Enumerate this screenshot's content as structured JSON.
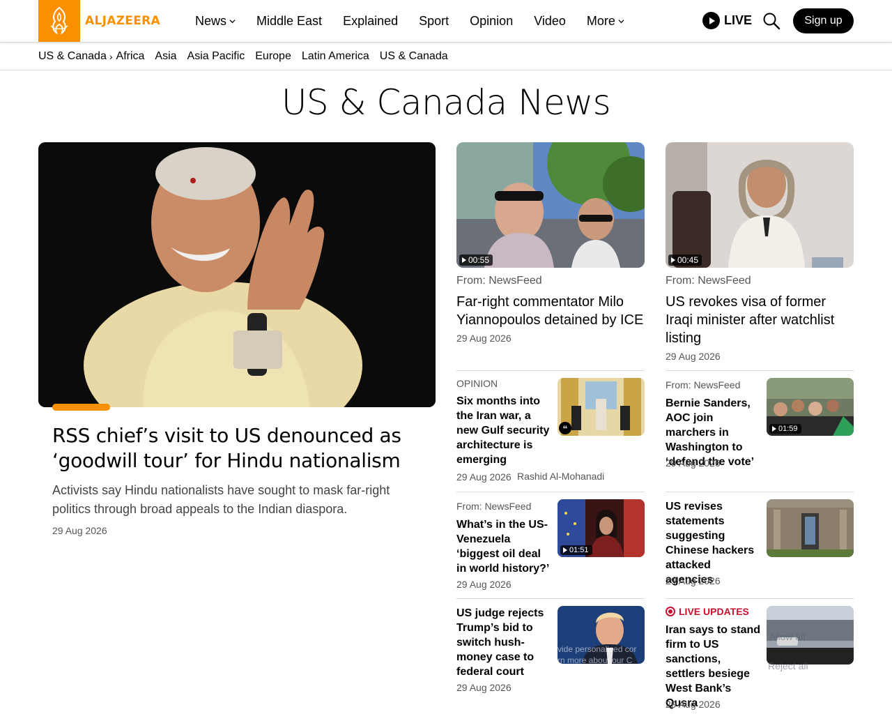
{
  "brand": {
    "name": "ALJAZEERA",
    "color": "#fa9000"
  },
  "nav": {
    "items": [
      {
        "label": "News",
        "dropdown": true
      },
      {
        "label": "Middle East",
        "dropdown": false
      },
      {
        "label": "Explained",
        "dropdown": false
      },
      {
        "label": "Sport",
        "dropdown": false
      },
      {
        "label": "Opinion",
        "dropdown": false
      },
      {
        "label": "Video",
        "dropdown": false
      },
      {
        "label": "More",
        "dropdown": true
      }
    ],
    "live_label": "LIVE",
    "signup_label": "Sign up"
  },
  "subnav": {
    "current": "US & Canada",
    "links": [
      "Africa",
      "Asia",
      "Asia Pacific",
      "Europe",
      "Latin America",
      "US & Canada"
    ]
  },
  "page_title": "US & Canada News",
  "featured": {
    "title": "RSS chief’s visit to US denounced as ‘goodwill tour’ for Hindu nationalism",
    "summary": "Activists say Hindu nationalists have sought to mask far-right politics through broad appeals to the Indian diaspora.",
    "date": "29 Aug 2026"
  },
  "cards": [
    {
      "source": "From: NewsFeed",
      "title": "Far-right commentator Milo Yiannopoulos detained by ICE",
      "date": "29 Aug 2026",
      "duration": "00:55"
    },
    {
      "source": "From: NewsFeed",
      "title": "US revokes visa of former Iraqi minister after watchlist listing",
      "date": "29 Aug 2026",
      "duration": "00:45"
    }
  ],
  "small_left": [
    {
      "label": "OPINION",
      "title": "Six months into the Iran war, a new Gulf security architecture is emerging",
      "date": "29 Aug 2026",
      "author": "Rashid Al-Mohanadi"
    },
    {
      "label": "From: NewsFeed",
      "title": "What’s in the US-Venezuela ‘biggest oil deal in world history?’",
      "date": "29 Aug 2026",
      "duration": "01:51"
    },
    {
      "title": "US judge rejects Trump’s bid to switch hush-money case to federal court",
      "date": "29 Aug 2026"
    }
  ],
  "small_right": [
    {
      "label": "From: NewsFeed",
      "title": "Bernie Sanders, AOC join marchers in Washington to ‘defend the vote’",
      "date": "29 Aug 2026",
      "duration": "01:59"
    },
    {
      "title": "US revises statements suggesting Chinese hackers attacked agencies",
      "date": "29 Aug 2026"
    },
    {
      "label": "LIVE UPDATES",
      "title": "Iran says to stand firm to US sanctions, settlers besiege West Bank’s Qusra",
      "date": "29 Aug 2026"
    }
  ],
  "cookie_overlay": {
    "text_1": "vide personalised cor",
    "text_2": "rn more about our C",
    "allow": "Allow all",
    "reject": "Reject all"
  }
}
